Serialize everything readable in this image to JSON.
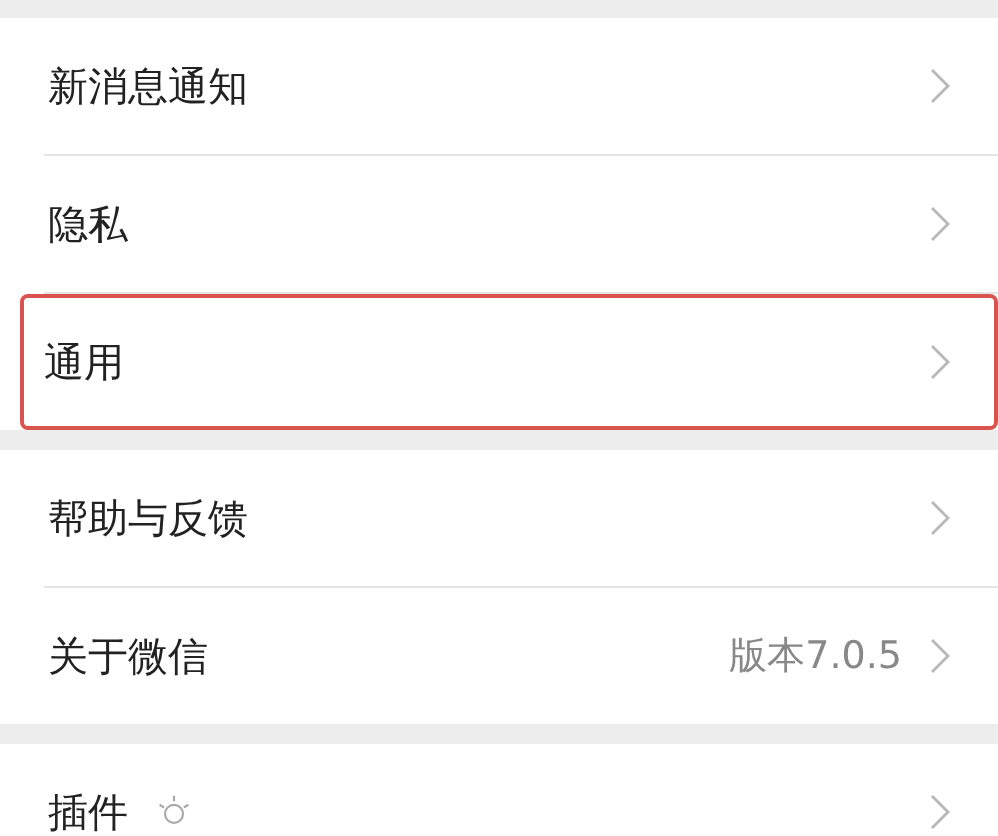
{
  "groups": [
    {
      "items": [
        {
          "label": "新消息通知",
          "kind": "plain",
          "highlighted": false
        },
        {
          "label": "隐私",
          "kind": "plain",
          "highlighted": false
        },
        {
          "label": "通用",
          "kind": "plain",
          "highlighted": true
        }
      ]
    },
    {
      "items": [
        {
          "label": "帮助与反馈",
          "kind": "plain",
          "highlighted": false
        },
        {
          "label": "关于微信",
          "value": "版本7.0.5",
          "kind": "plain",
          "highlighted": false
        }
      ]
    },
    {
      "items": [
        {
          "label": "插件",
          "kind": "with_icon",
          "highlighted": false
        }
      ]
    }
  ]
}
